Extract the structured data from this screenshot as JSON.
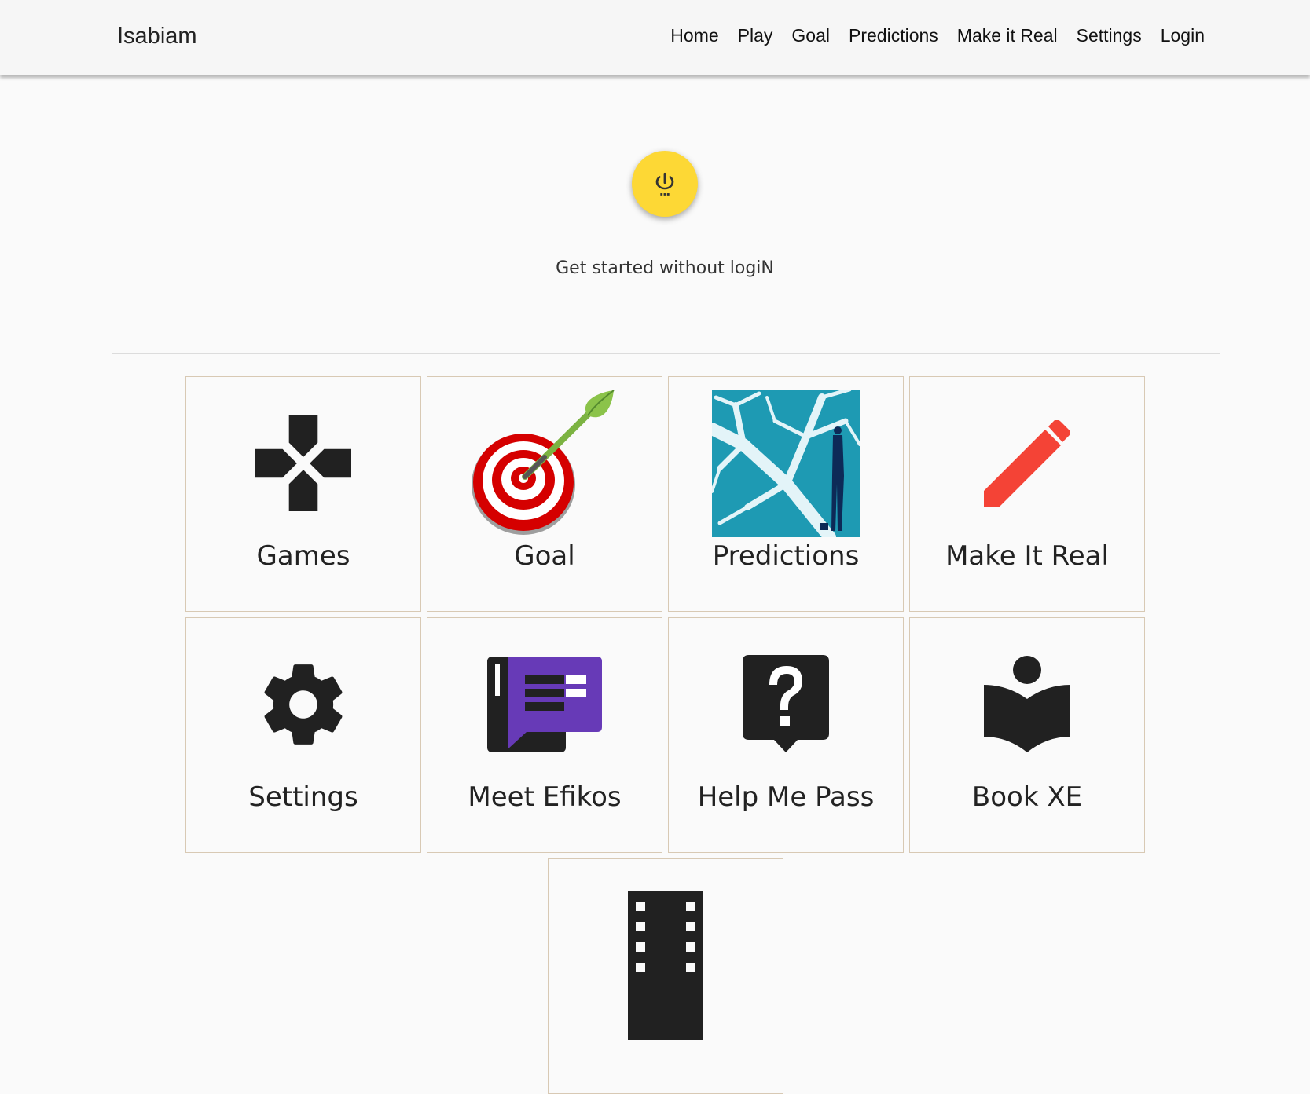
{
  "navbar": {
    "brand": "Isabiam",
    "links": [
      "Home",
      "Play",
      "Goal",
      "Predictions",
      "Make it Real",
      "Settings",
      "Login"
    ]
  },
  "hero": {
    "button_icon": "power-icon",
    "text": "Get started without logiN"
  },
  "tiles": [
    {
      "label": "Games",
      "icon": "gamepad-icon"
    },
    {
      "label": "Goal",
      "icon": "dart-target-icon"
    },
    {
      "label": "Predictions",
      "icon": "branching-paths-image"
    },
    {
      "label": "Make It Real",
      "icon": "pencil-icon"
    },
    {
      "label": "Settings",
      "icon": "gear-icon"
    },
    {
      "label": "Meet Efikos",
      "icon": "chat-book-icon"
    },
    {
      "label": "Help Me Pass",
      "icon": "help-question-icon"
    },
    {
      "label": "Book XE",
      "icon": "reading-book-icon"
    },
    {
      "label": "",
      "icon": "film-strip-icon"
    }
  ],
  "colors": {
    "accent_yellow": "#fdd835",
    "pencil_red": "#f44336",
    "chat_purple": "#673ab7",
    "dart_red": "#d50000",
    "dart_green": "#7cb342",
    "predictions_teal": "#1e9ab3",
    "icon_dark": "#212121"
  }
}
